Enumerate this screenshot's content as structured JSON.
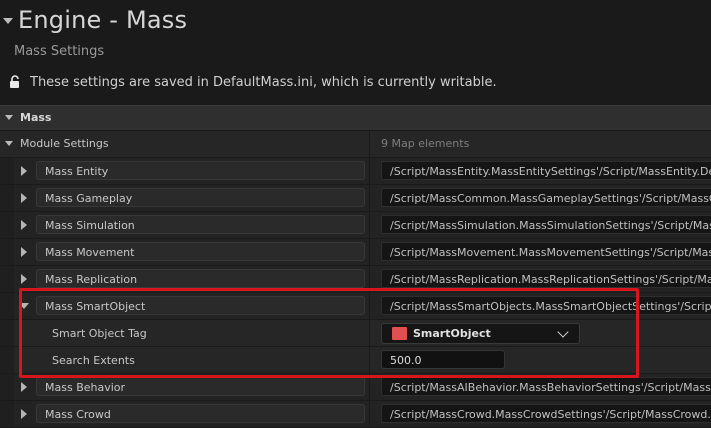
{
  "header": {
    "title": "Engine - Mass",
    "subtitle": "Mass Settings",
    "notice": "These settings are saved in DefaultMass.ini, which is currently writable."
  },
  "section": {
    "label": "Mass"
  },
  "module_settings": {
    "label": "Module Settings",
    "count": "9 Map elements"
  },
  "entries": [
    {
      "key": "Mass Entity",
      "value": "/Script/MassEntity.MassEntitySettings'/Script/MassEntity.Defa"
    },
    {
      "key": "Mass Gameplay",
      "value": "/Script/MassCommon.MassGameplaySettings'/Script/MassCo"
    },
    {
      "key": "Mass Simulation",
      "value": "/Script/MassSimulation.MassSimulationSettings'/Script/MassS"
    },
    {
      "key": "Mass Movement",
      "value": "/Script/MassMovement.MassMovementSettings'/Script/MassM"
    },
    {
      "key": "Mass Replication",
      "value": "/Script/MassReplication.MassReplicationSettings'/Script/Mass"
    },
    {
      "key": "Mass SmartObject",
      "value": "/Script/MassSmartObjects.MassSmartObjectSettings'/Script/M"
    },
    {
      "key": "Mass Behavior",
      "value": "/Script/MassAIBehavior.MassBehaviorSettings'/Script/MassAI"
    },
    {
      "key": "Mass Crowd",
      "value": "/Script/MassCrowd.MassCrowdSettings'/Script/MassCrowd.Def"
    }
  ],
  "smartobject": {
    "tag_label": "Smart Object Tag",
    "tag_value": "SmartObject",
    "tag_color": "#e05050",
    "extents_label": "Search Extents",
    "extents_value": "500.0"
  },
  "colors": {
    "highlight": "#d6151d"
  }
}
